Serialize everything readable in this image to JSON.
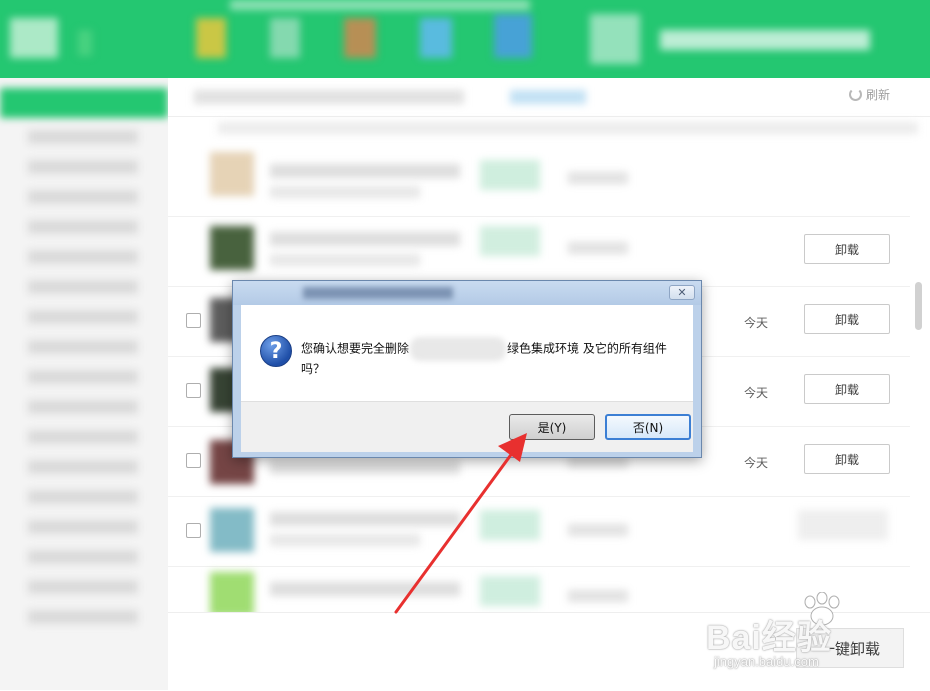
{
  "toolbar": {
    "refresh_label": "刷新"
  },
  "list": {
    "rows": [
      {
        "today": "",
        "uninstall": ""
      },
      {
        "today": "",
        "uninstall": "卸载"
      },
      {
        "today": "今天",
        "uninstall": "卸载"
      },
      {
        "today": "今天",
        "uninstall": "卸载"
      },
      {
        "today": "今天",
        "uninstall": "卸载"
      }
    ]
  },
  "footer": {
    "one_key_uninstall": "一键卸载"
  },
  "dialog": {
    "close_glyph": "✕",
    "message_prefix": "您确认想要完全删除",
    "message_suffix": "绿色集成环境 及它的所有组件",
    "message_line2": "吗？",
    "question_glyph": "?",
    "yes_label": "是(Y)",
    "no_label": "否(N)"
  },
  "watermark": {
    "main": "Bai经验",
    "sub": "jingyan.baidu.com"
  },
  "colors": {
    "brand_green": "#19c46a",
    "annotation_red": "#e8302f",
    "default_button_border": "#3c7fd4"
  }
}
